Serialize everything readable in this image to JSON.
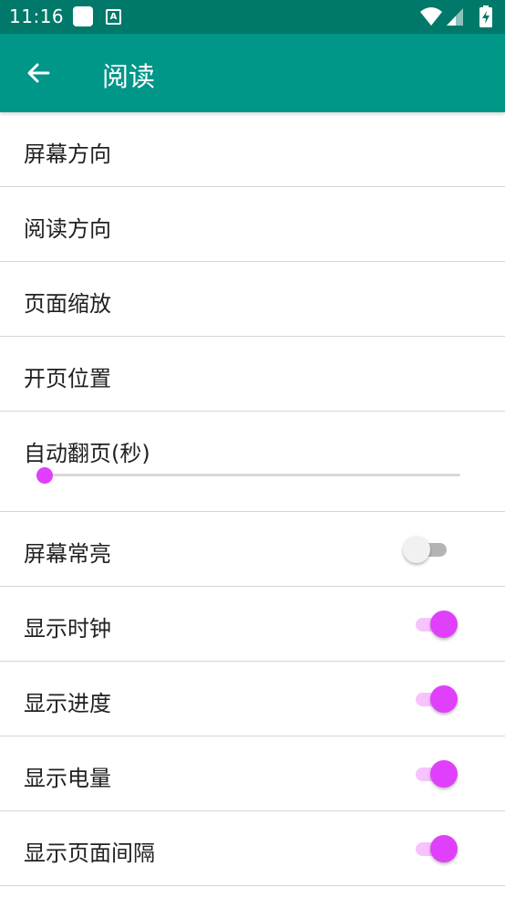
{
  "status_bar": {
    "time": "11:16",
    "icons": [
      "notification-square-icon",
      "a-badge-icon",
      "wifi-icon",
      "signal-icon",
      "battery-charging-icon"
    ]
  },
  "app_bar": {
    "title": "阅读",
    "back_icon": "arrow-left-icon"
  },
  "colors": {
    "status_bar": "#00796b",
    "app_bar": "#009688",
    "accent": "#e040fb",
    "switch_off_track": "#b4b4b4",
    "divider": "#d6d6d6"
  },
  "settings": {
    "screen_orientation": "屏幕方向",
    "reading_direction": "阅读方向",
    "page_zoom": "页面缩放",
    "start_page_position": "开页位置",
    "auto_page_turn": {
      "label": "自动翻页(秒)",
      "value_fraction": 0
    },
    "keep_screen_on": {
      "label": "屏幕常亮",
      "checked": false
    },
    "show_clock": {
      "label": "显示时钟",
      "checked": true
    },
    "show_progress": {
      "label": "显示进度",
      "checked": true
    },
    "show_battery": {
      "label": "显示电量",
      "checked": true
    },
    "show_page_gap": {
      "label": "显示页面间隔",
      "checked": true
    }
  }
}
